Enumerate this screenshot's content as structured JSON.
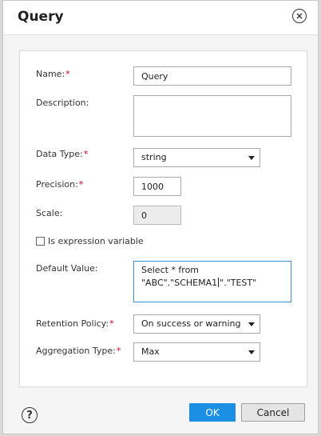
{
  "dialog": {
    "title": "Query"
  },
  "form": {
    "name_label": "Name:",
    "name_value": "Query",
    "description_label": "Description:",
    "description_value": "",
    "data_type_label": "Data Type:",
    "data_type_value": "string",
    "precision_label": "Precision:",
    "precision_value": "1000",
    "scale_label": "Scale:",
    "scale_value": "0",
    "expression_variable_label": "Is expression variable",
    "expression_variable_checked": false,
    "default_value_label": "Default Value:",
    "default_value_line1": "Select * from",
    "default_value_line2_before": "\"ABC\".\"SCHEMA1",
    "default_value_line2_after": "\".\"TEST\"",
    "retention_policy_label": "Retention Policy:",
    "retention_policy_value": "On success or warning",
    "aggregation_type_label": "Aggregation Type:",
    "aggregation_type_value": "Max",
    "required_marker": "*"
  },
  "footer": {
    "help_label": "?",
    "ok_label": "OK",
    "cancel_label": "Cancel"
  },
  "colors": {
    "primary": "#1a8fe3",
    "required": "#d0021b",
    "focus_border": "#3a8fd0"
  },
  "icons": {
    "close": "close-icon",
    "help": "help-icon",
    "dropdown": "chevron-down-icon"
  }
}
